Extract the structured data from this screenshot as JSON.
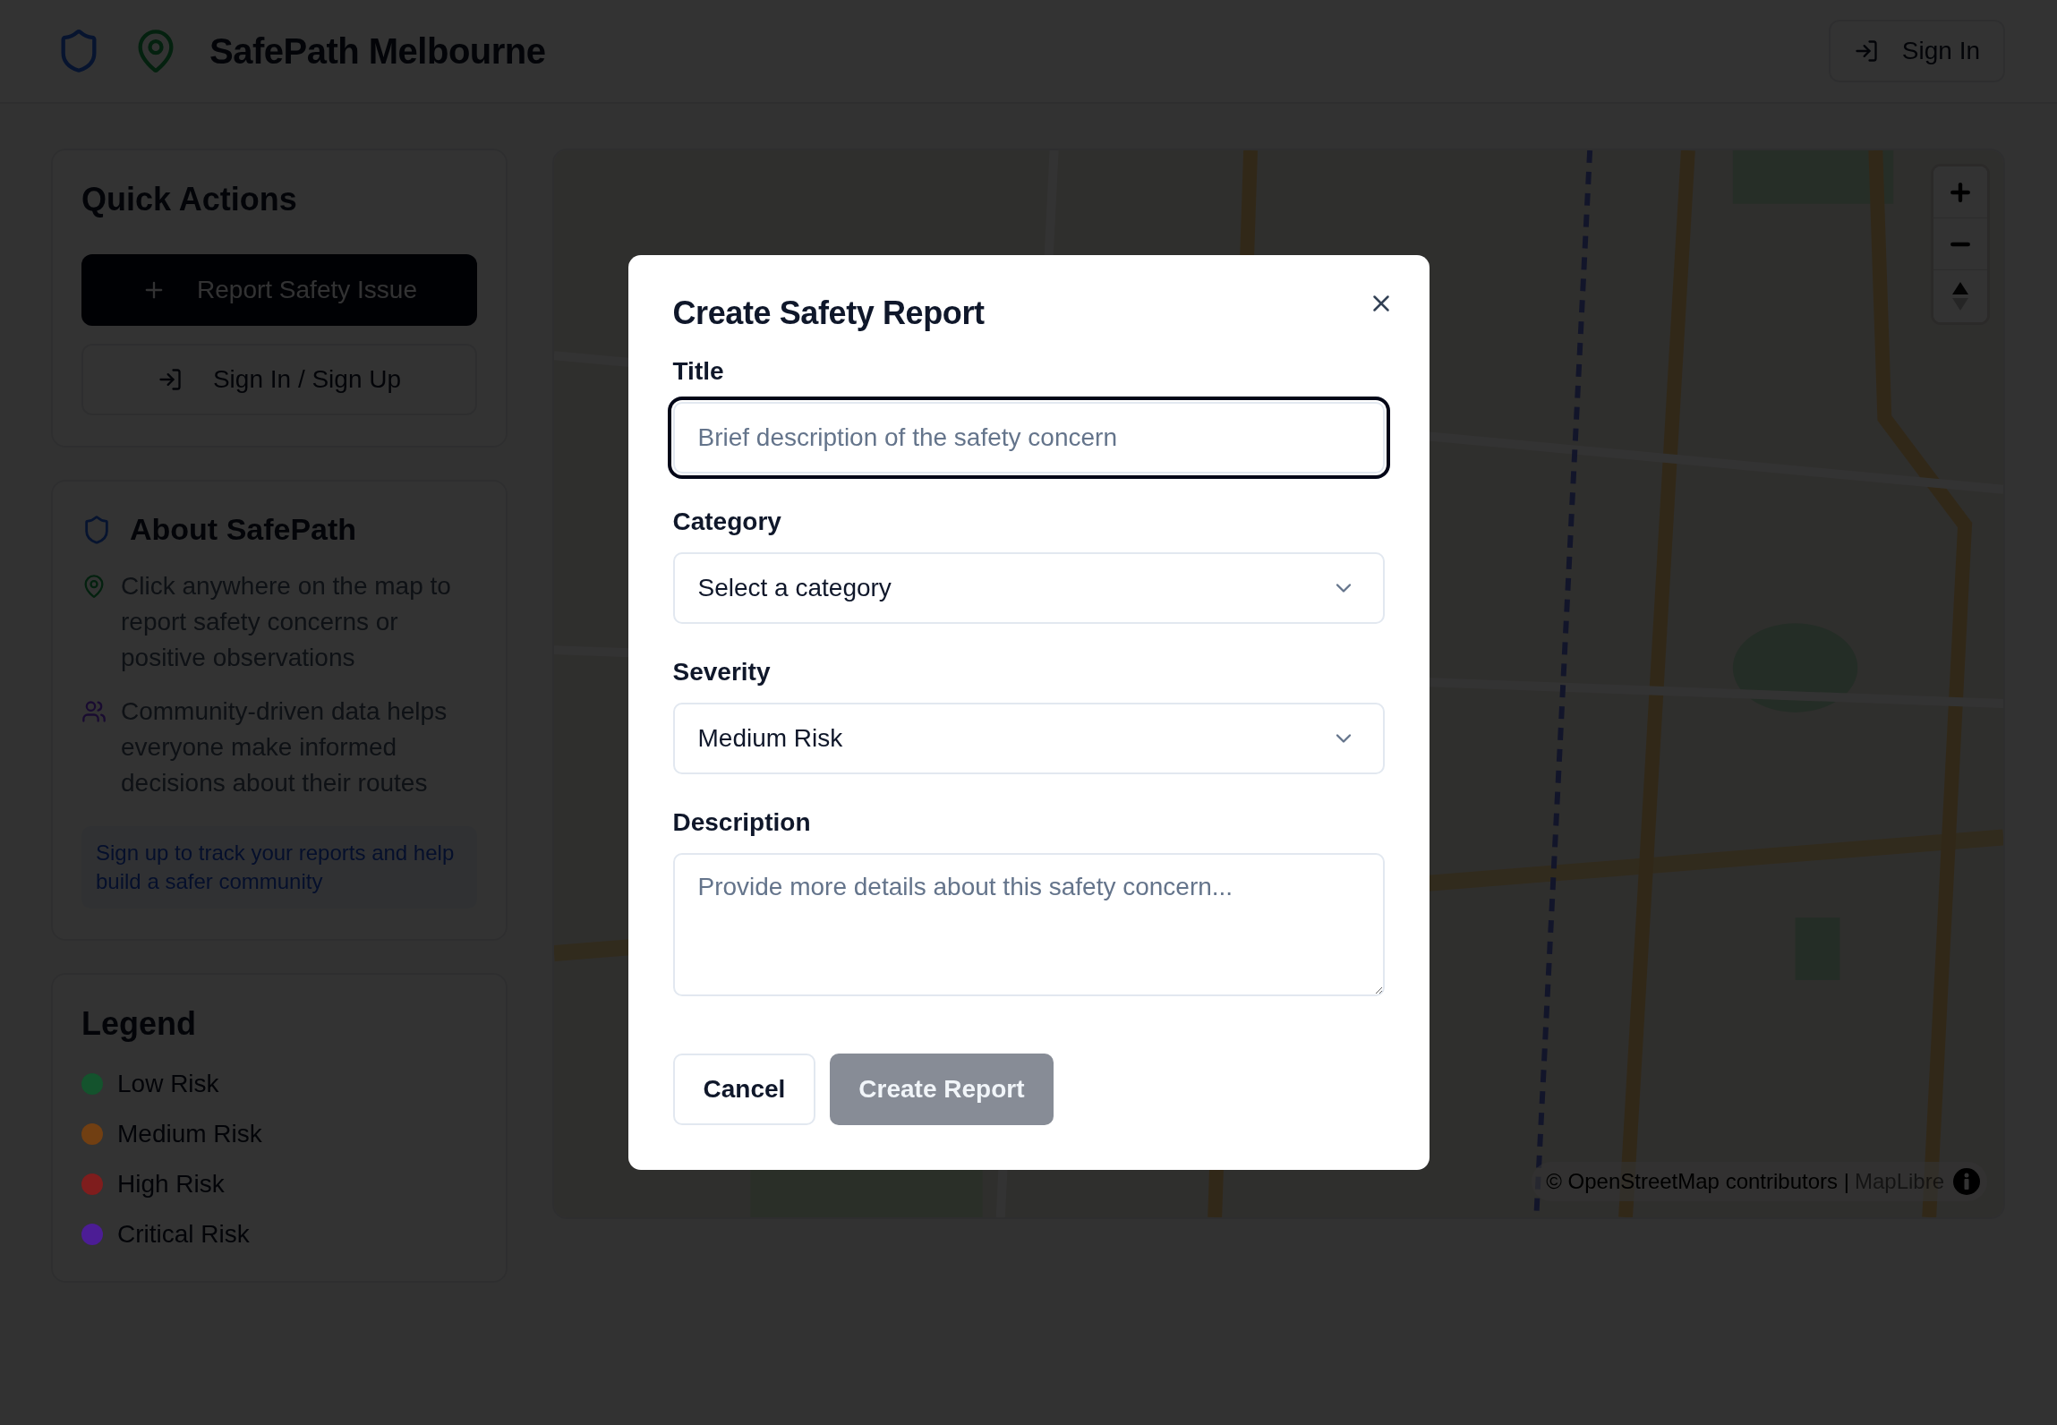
{
  "header": {
    "title": "SafePath Melbourne",
    "sign_in": "Sign In"
  },
  "quick_actions": {
    "title": "Quick Actions",
    "buttons": [
      {
        "label": "Report Safety Issue",
        "kind": "primary"
      },
      {
        "label": "Sign In / Sign Up",
        "kind": "outline"
      }
    ]
  },
  "about": {
    "title": "About SafePath",
    "items": [
      {
        "kind": "pin",
        "text": "Click anywhere on the map to report safety concerns or positive observations"
      },
      {
        "kind": "users",
        "text": "Community-driven data helps everyone make informed decisions about their routes"
      }
    ],
    "note": "Sign up to track your reports and help build a safer community"
  },
  "legend": {
    "title": "Legend",
    "items": [
      {
        "label": "Low Risk",
        "color": "#14532d"
      },
      {
        "label": "Medium Risk",
        "color": "#713f12"
      },
      {
        "label": "High Risk",
        "color": "#7f1d1d"
      },
      {
        "label": "Critical Risk",
        "color": "#4c1d95"
      }
    ]
  },
  "map": {
    "attribution": "© OpenStreetMap contributors |",
    "attribution_link": "MapLibre"
  },
  "dialog": {
    "title": "Create Safety Report",
    "fields": [
      {
        "kind": "input",
        "label": "Title",
        "placeholder": "Brief description of the safety concern",
        "focused": true
      },
      {
        "kind": "select",
        "label": "Category",
        "value": "Select a category",
        "focused": false
      },
      {
        "kind": "select",
        "label": "Severity",
        "value": "Medium Risk",
        "focused": false
      },
      {
        "kind": "textarea",
        "label": "Description",
        "placeholder": "Provide more details about this safety concern...",
        "focused": false
      }
    ],
    "buttons": [
      {
        "label": "Cancel",
        "kind": "outline",
        "disabled": false
      },
      {
        "label": "Create Report",
        "kind": "primary",
        "disabled": true
      }
    ]
  }
}
